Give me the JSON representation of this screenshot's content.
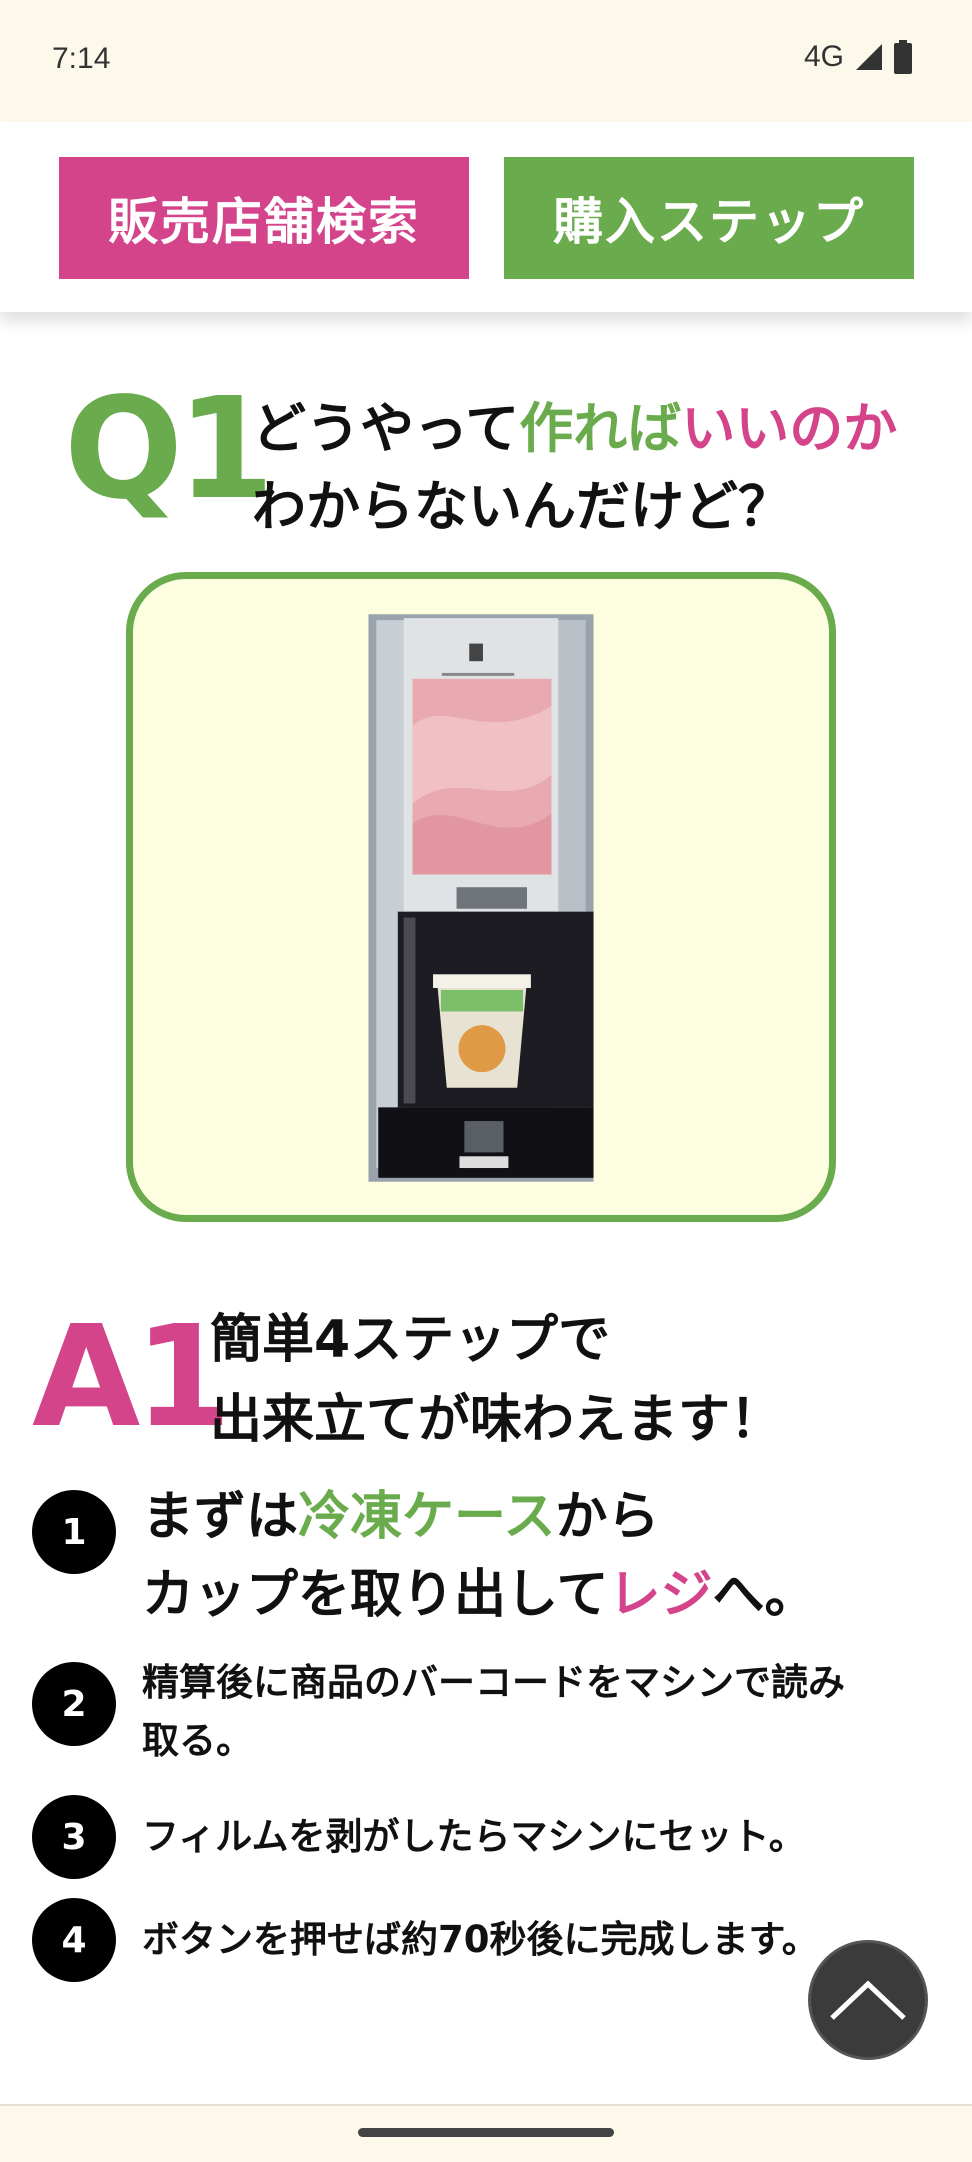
{
  "status_bar": {
    "time": "7:14",
    "network": "4G",
    "icons": [
      "signal-icon",
      "battery-icon"
    ]
  },
  "nav": {
    "store_search": "販売店舗検索",
    "purchase_steps": "購入ステップ"
  },
  "question": {
    "mark": "Q1",
    "line1_a": "どうやって",
    "line1_b": "作れば",
    "line1_c": "いいのか",
    "line2": "わからないんだけど？"
  },
  "photo": {
    "icon": "frozen-smoothie-machine-photo"
  },
  "answer": {
    "mark": "A1",
    "line1": "簡単4ステップで",
    "line2": "出来立てが味わえます！"
  },
  "steps": [
    {
      "num": "1",
      "a": "まずは",
      "b": "冷凍ケース",
      "c": "から",
      "d": "カップを取り出して",
      "e": "レジ",
      "f": "へ。"
    },
    {
      "num": "2",
      "line1": "精算後に商品のバーコードをマシンで読み",
      "line2": "取る。"
    },
    {
      "num": "3",
      "text": "フィルムを剥がしたらマシンにセット。"
    },
    {
      "num": "4",
      "text": "ボタンを押せば約70秒後に完成します。"
    }
  ],
  "scroll_top": {
    "icon": "chevron-up-icon"
  },
  "colors": {
    "pink": "#d3448b",
    "green": "#6aab4d",
    "cream": "#fdfde0"
  }
}
